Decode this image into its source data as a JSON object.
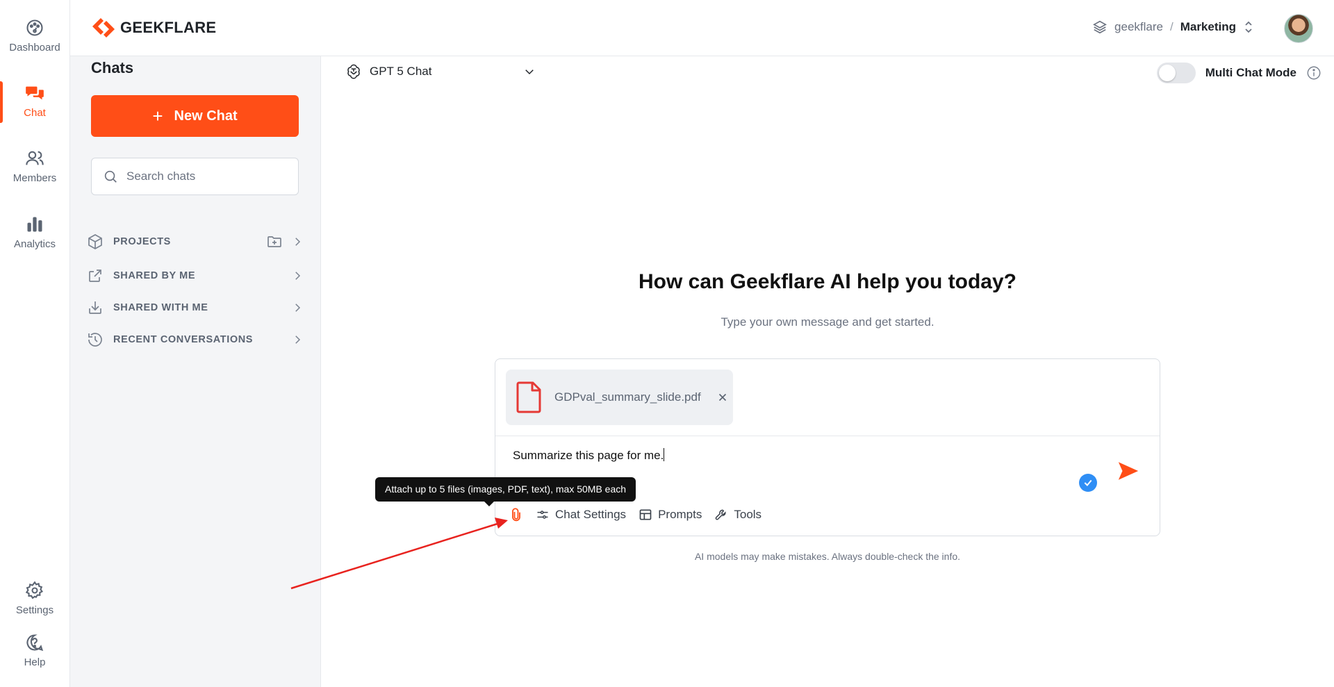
{
  "rail": {
    "items": [
      {
        "label": "Dashboard",
        "icon": "dashboard-icon"
      },
      {
        "label": "Chat",
        "icon": "chat-icon"
      },
      {
        "label": "Members",
        "icon": "members-icon"
      },
      {
        "label": "Analytics",
        "icon": "analytics-icon"
      },
      {
        "label": "Settings",
        "icon": "gear-icon"
      },
      {
        "label": "Help",
        "icon": "help-icon"
      }
    ],
    "active": "Chat"
  },
  "header": {
    "logo_text": "GEEKFLARE",
    "workspace": "geekflare",
    "separator": "/",
    "team": "Marketing"
  },
  "sidebar": {
    "title": "Chats",
    "new_chat_label": "New Chat",
    "search_placeholder": "Search chats",
    "sections": [
      {
        "label": "PROJECTS",
        "icon": "cube-icon"
      },
      {
        "label": "SHARED BY ME",
        "icon": "share-out-icon"
      },
      {
        "label": "SHARED WITH ME",
        "icon": "share-in-icon"
      },
      {
        "label": "RECENT CONVERSATIONS",
        "icon": "history-icon"
      }
    ]
  },
  "main": {
    "model": "GPT 5 Chat",
    "multi_chat_label": "Multi Chat Mode",
    "multi_chat_enabled": false,
    "hero_title": "How can Geekflare AI help you today?",
    "hero_subtitle": "Type your own message and get started.",
    "composer": {
      "attachment_name": "GDPval_summary_slide.pdf",
      "prompt_text": "Summarize this page for me.",
      "tools": [
        "Chat Settings",
        "Prompts",
        "Tools"
      ]
    },
    "tooltip": "Attach up to 5 files (images, PDF, text), max 50MB each",
    "disclaimer": "AI models may make mistakes. Always double-check the info."
  },
  "colors": {
    "accent": "#ff4e17",
    "annotation_arrow": "#e8231f",
    "check_blue": "#2f8ef5",
    "file_icon_red": "#e53935"
  }
}
